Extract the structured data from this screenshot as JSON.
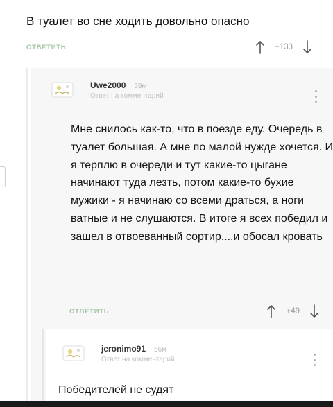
{
  "top_comment": {
    "text": "В туалет во сне ходить довольно опасно",
    "reply_label": "ОТВЕТИТЬ",
    "score": "+133",
    "upvote_icon": "arrow-up-icon",
    "downvote_icon": "arrow-down-icon"
  },
  "reply_comment": {
    "username": "Uwe2000",
    "time": "59м",
    "reply_to": "Ответ на комментарий",
    "text": "Мне снилось как-то, что в поезде еду. Очередь в туалет большая. А мне по малой нужде хочется.  И я терплю в очереди и тут какие-то цыгане начинают туда лезть, потом какие-то бухие мужики - я начинаю со всеми драться, а ноги ватные и не слушаются. В итоге я всех победил и зашел в отвоеванный сортир....и обосал кровать",
    "reply_label": "ОТВЕТИТЬ",
    "score": "+49",
    "avatar_icon": "avatar-icon",
    "menu_icon": "kebab-menu-icon"
  },
  "nested_comment": {
    "username": "jeronimo91",
    "time": "56м",
    "reply_to": "Ответ на комментарий",
    "text": "Победителей не судят",
    "avatar_icon": "avatar-icon",
    "menu_icon": "kebab-menu-icon"
  },
  "colors": {
    "reply_link": "#9fc39f",
    "thread_background": "#f7f7f7",
    "meta_text": "#c2c2c2"
  }
}
